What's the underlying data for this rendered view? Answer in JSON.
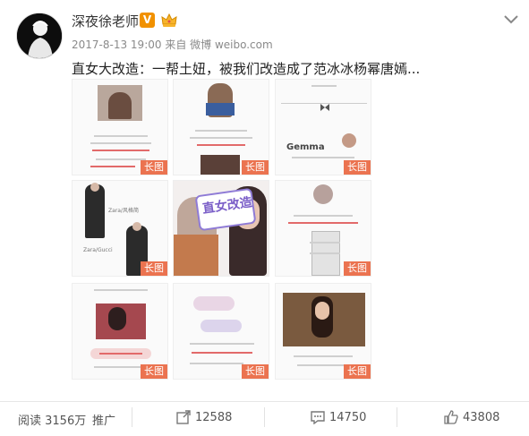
{
  "post": {
    "author": "深夜徐老师",
    "verified_badge": "V",
    "meta": "2017-8-13 19:00 来自 微博 weibo.com",
    "text": "直女大改造：一帮土妞，被我们改造成了范冰冰杨幂唐嫣...",
    "image_badge": "长图",
    "tile_texts": {
      "gemma": "Gemma",
      "zara_1": "Zara/风格简",
      "zara_2": "Zara/Gucci",
      "promo": "直女改造"
    }
  },
  "footer": {
    "read_label": "阅读 3156万",
    "promote_label": "推广",
    "reposts": "12588",
    "comments": "14750",
    "likes": "43808"
  },
  "colors": {
    "badge": "#eb7350",
    "verified": "#f19100",
    "meta_gray": "#8a8a8a"
  }
}
